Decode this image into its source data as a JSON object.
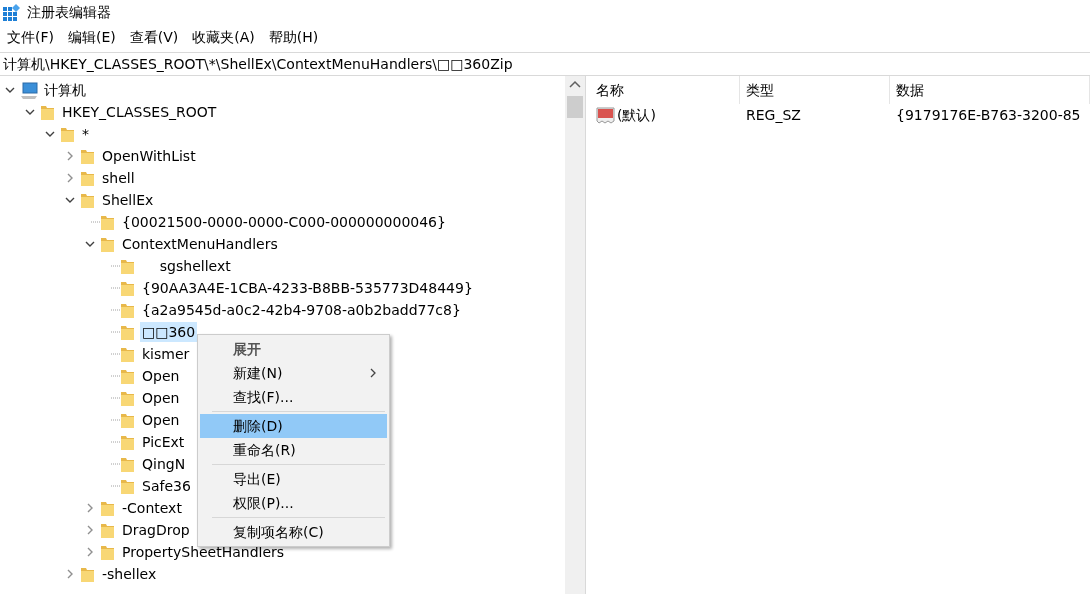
{
  "window": {
    "title": "注册表编辑器"
  },
  "menu_bar": [
    "文件(F)",
    "编辑(E)",
    "查看(V)",
    "收藏夹(A)",
    "帮助(H)"
  ],
  "address": "计算机\\HKEY_CLASSES_ROOT\\*\\ShellEx\\ContextMenuHandlers\\□□360Zip",
  "tree": [
    {
      "label": "计算机",
      "kind": "computer",
      "expanded": true,
      "selected": false,
      "children": [
        {
          "label": "HKEY_CLASSES_ROOT",
          "kind": "branch",
          "expanded": true,
          "selected": false,
          "children": [
            {
              "label": "*",
              "kind": "branch",
              "expanded": true,
              "selected": false,
              "children": [
                {
                  "label": "OpenWithList",
                  "kind": "branch",
                  "expanded": false,
                  "selected": false
                },
                {
                  "label": "shell",
                  "kind": "branch",
                  "expanded": false,
                  "selected": false
                },
                {
                  "label": "ShellEx",
                  "kind": "branch",
                  "expanded": true,
                  "selected": false,
                  "children": [
                    {
                      "label": "{00021500-0000-0000-C000-000000000046}",
                      "kind": "leaf",
                      "selected": false
                    },
                    {
                      "label": "ContextMenuHandlers",
                      "kind": "branch",
                      "expanded": true,
                      "selected": false,
                      "children": [
                        {
                          "label": "    sgshellext",
                          "kind": "leaf",
                          "selected": false
                        },
                        {
                          "label": "{90AA3A4E-1CBA-4233-B8BB-535773D48449}",
                          "kind": "leaf",
                          "selected": false
                        },
                        {
                          "label": "{a2a9545d-a0c2-42b4-9708-a0b2badd77c8}",
                          "kind": "leaf",
                          "selected": false
                        },
                        {
                          "label": "□□360",
                          "kind": "leaf",
                          "selected": true
                        },
                        {
                          "label": "kismer",
                          "kind": "leaf",
                          "selected": false
                        },
                        {
                          "label": "Open",
                          "kind": "leaf",
                          "selected": false
                        },
                        {
                          "label": "Open",
                          "kind": "leaf",
                          "selected": false
                        },
                        {
                          "label": "Open",
                          "kind": "leaf",
                          "selected": false
                        },
                        {
                          "label": "PicExt",
                          "kind": "leaf",
                          "selected": false
                        },
                        {
                          "label": "QingN",
                          "kind": "leaf",
                          "selected": false
                        },
                        {
                          "label": "Safe36",
                          "kind": "leaf",
                          "selected": false
                        }
                      ]
                    },
                    {
                      "label": "-Context",
                      "kind": "branch",
                      "expanded": false,
                      "selected": false
                    },
                    {
                      "label": "DragDrop",
                      "kind": "branch",
                      "expanded": false,
                      "selected": false
                    },
                    {
                      "label": "PropertySheetHandlers",
                      "kind": "branch",
                      "expanded": false,
                      "selected": false
                    }
                  ]
                },
                {
                  "label": "-shellex",
                  "kind": "branch",
                  "expanded": false,
                  "selected": false
                }
              ]
            }
          ]
        }
      ]
    }
  ],
  "values": {
    "columns": [
      "名称",
      "类型",
      "数据"
    ],
    "rows": [
      {
        "name": "(默认)",
        "type": "REG_SZ",
        "data": "{9179176E-B763-3200-85"
      }
    ]
  },
  "context_menu": [
    {
      "kind": "item",
      "label": "展开",
      "bold": true,
      "submenu": false,
      "selected": false
    },
    {
      "kind": "item",
      "label": "新建(N)",
      "bold": false,
      "submenu": true,
      "selected": false
    },
    {
      "kind": "item",
      "label": "查找(F)...",
      "bold": false,
      "submenu": false,
      "selected": false
    },
    {
      "kind": "separator"
    },
    {
      "kind": "item",
      "label": "删除(D)",
      "bold": false,
      "submenu": false,
      "selected": true
    },
    {
      "kind": "item",
      "label": "重命名(R)",
      "bold": false,
      "submenu": false,
      "selected": false
    },
    {
      "kind": "separator"
    },
    {
      "kind": "item",
      "label": "导出(E)",
      "bold": false,
      "submenu": false,
      "selected": false
    },
    {
      "kind": "item",
      "label": "权限(P)...",
      "bold": false,
      "submenu": false,
      "selected": false
    },
    {
      "kind": "separator"
    },
    {
      "kind": "item",
      "label": "复制项名称(C)",
      "bold": false,
      "submenu": false,
      "selected": false
    }
  ]
}
